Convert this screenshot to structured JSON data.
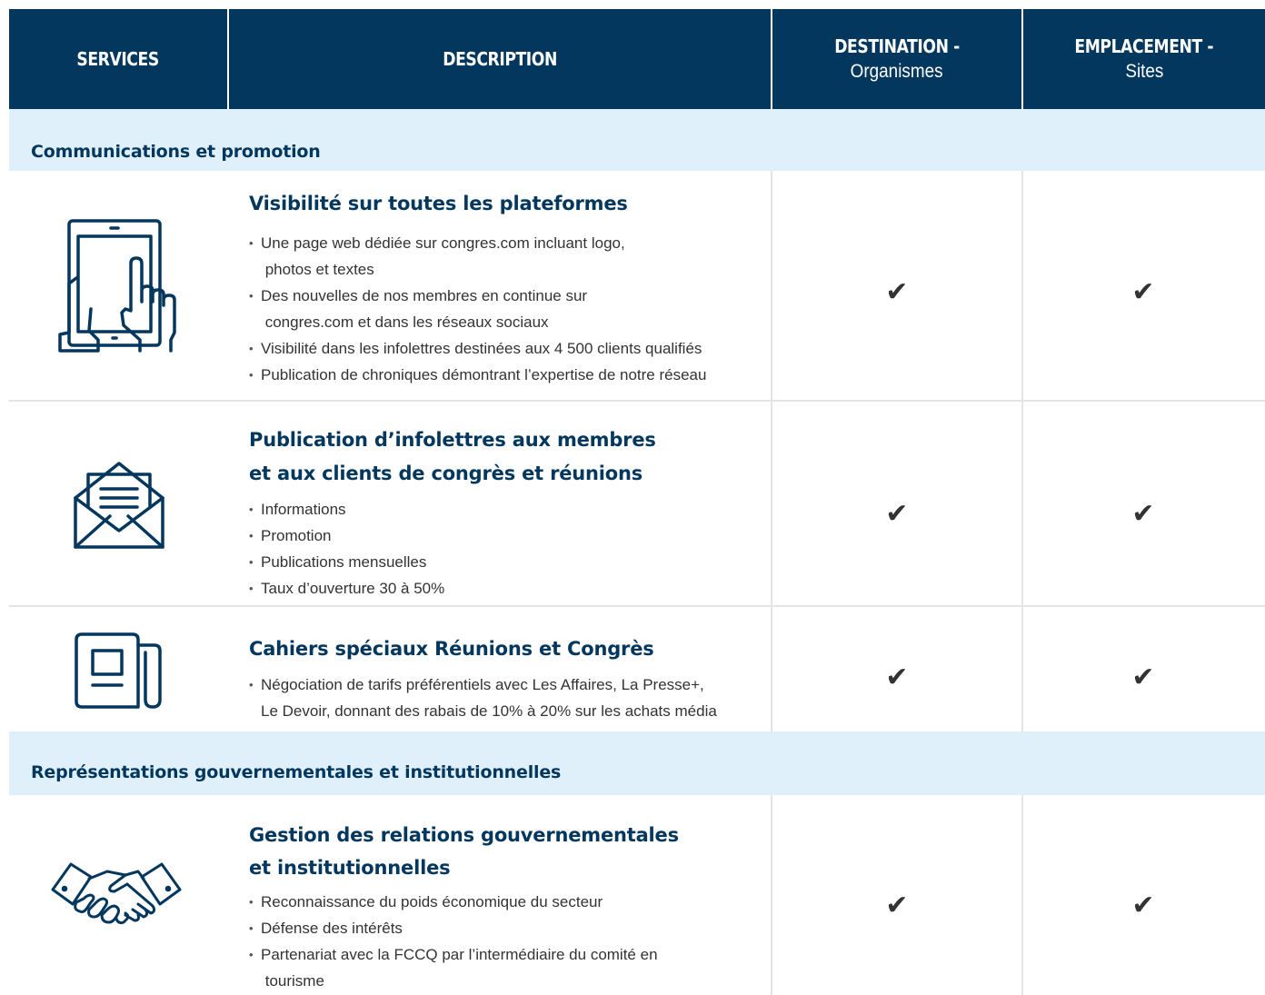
{
  "header": {
    "services": "SERVICES",
    "description": "DESCRIPTION",
    "destination_title": "DESTINATION -",
    "destination_sub": "Organismes",
    "emplacement_title": "EMPLACEMENT -",
    "emplacement_sub": "Sites"
  },
  "sections": [
    {
      "label": "Communications et promotion"
    },
    {
      "label": "Représentations gouvernementales et institutionnelles"
    }
  ],
  "rows": [
    {
      "icon": "tablet-touch-icon",
      "title_lines": [
        "Visibilité sur toutes les plateformes"
      ],
      "bullets": [
        "Une page web dédiée sur congres.com incluant logo,\n photos et textes",
        "Des nouvelles de nos membres en continue sur\n congres.com et dans les réseaux sociaux",
        "Visibilité dans les infolettres destinées aux 4 500 clients qualifiés",
        "Publication de chroniques démontrant l’expertise de notre réseau"
      ],
      "destination": "✔",
      "emplacement": "✔"
    },
    {
      "icon": "envelope-letter-icon",
      "title_lines": [
        "Publication d’infolettres aux membres",
        "et aux clients de congrès et réunions"
      ],
      "bullets": [
        "Informations",
        "Promotion",
        "Publications mensuelles",
        "Taux d’ouverture 30 à 50%"
      ],
      "destination": "✔",
      "emplacement": "✔"
    },
    {
      "icon": "newspaper-icon",
      "title_lines": [
        "Cahiers spéciaux Réunions et Congrès"
      ],
      "bullets": [
        "Négociation de tarifs préférentiels avec Les Affaires, La Presse+,\nLe Devoir, donnant des rabais de 10% à 20% sur les achats média"
      ],
      "destination": "✔",
      "emplacement": "✔"
    },
    {
      "icon": "handshake-icon",
      "title_lines": [
        "Gestion des relations gouvernementales",
        "et institutionnelles"
      ],
      "bullets": [
        "Reconnaissance du poids économique du secteur",
        "Défense des intérêts",
        "Partenariat avec la FCCQ par l’intermédiaire du comité en\n tourisme"
      ],
      "destination": "✔",
      "emplacement": "✔"
    }
  ],
  "colors": {
    "header_bg": "#03375e",
    "section_bg": "#dff0fb",
    "title_text": "#03375e",
    "grid_line": "#e4e4e4"
  }
}
